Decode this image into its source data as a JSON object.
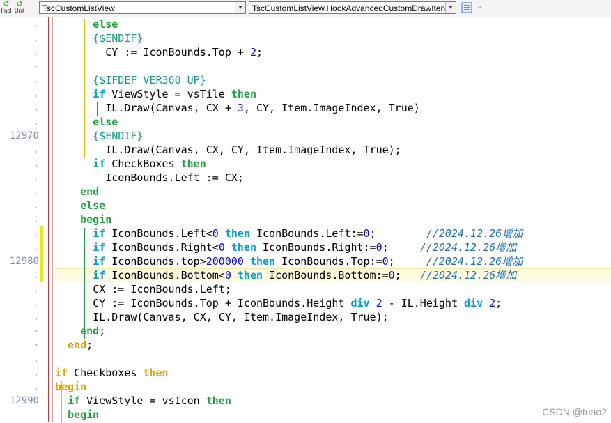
{
  "toolbar": {
    "impl_label": "Impl",
    "unit_label": "Unit",
    "class_combo": "TscCustomListView",
    "method_combo": "TscCustomListView.HookAdvancedCustomDrawIten"
  },
  "gutter": {
    "markers": [
      ".",
      ".",
      ".",
      " -",
      ".",
      ".",
      ".",
      ".",
      "12970",
      ".",
      ".",
      ".",
      ".",
      ".",
      ".",
      ".",
      ".",
      "12980",
      ".",
      ".",
      ".",
      ".",
      "-",
      "-",
      ".",
      ".",
      ".",
      "12990"
    ]
  },
  "code": [
    {
      "indent": "      ",
      "tokens": [
        {
          "t": "else",
          "c": "kwb"
        }
      ]
    },
    {
      "indent": "      ",
      "tokens": [
        {
          "t": "{$ENDIF}",
          "c": "dir"
        }
      ]
    },
    {
      "indent": "        ",
      "tokens": [
        {
          "t": "CY := IconBounds.Top + ",
          "c": "plain"
        },
        {
          "t": "2",
          "c": "num"
        },
        {
          "t": ";",
          "c": "plain"
        }
      ]
    },
    {
      "indent": "",
      "tokens": []
    },
    {
      "indent": "      ",
      "tokens": [
        {
          "t": "{$IFDEF VER360_UP}",
          "c": "dir"
        }
      ]
    },
    {
      "indent": "      ",
      "tokens": [
        {
          "t": "if",
          "c": "kw"
        },
        {
          "t": " ViewStyle = vsTile ",
          "c": "plain"
        },
        {
          "t": "then",
          "c": "kwb"
        }
      ]
    },
    {
      "indent": "        ",
      "tokens": [
        {
          "t": "IL.Draw(Canvas, CX + ",
          "c": "plain"
        },
        {
          "t": "3",
          "c": "num"
        },
        {
          "t": ", CY, Item.ImageIndex, True)",
          "c": "plain"
        }
      ]
    },
    {
      "indent": "      ",
      "tokens": [
        {
          "t": "else",
          "c": "kwb"
        }
      ]
    },
    {
      "indent": "      ",
      "tokens": [
        {
          "t": "{$ENDIF}",
          "c": "dir"
        }
      ]
    },
    {
      "indent": "        ",
      "tokens": [
        {
          "t": "IL.Draw(Canvas, CX, CY, Item.ImageIndex, True);",
          "c": "plain"
        }
      ]
    },
    {
      "indent": "      ",
      "tokens": [
        {
          "t": "if",
          "c": "kw"
        },
        {
          "t": " CheckBoxes ",
          "c": "plain"
        },
        {
          "t": "then",
          "c": "kwb"
        }
      ]
    },
    {
      "indent": "        ",
      "tokens": [
        {
          "t": "IconBounds.Left := CX;",
          "c": "plain"
        }
      ]
    },
    {
      "indent": "    ",
      "tokens": [
        {
          "t": "end",
          "c": "kwb"
        }
      ]
    },
    {
      "indent": "    ",
      "tokens": [
        {
          "t": "else",
          "c": "kwb"
        }
      ]
    },
    {
      "indent": "    ",
      "tokens": [
        {
          "t": "begin",
          "c": "kwb"
        }
      ]
    },
    {
      "indent": "      ",
      "tokens": [
        {
          "t": "if",
          "c": "kw"
        },
        {
          "t": " IconBounds.Left<",
          "c": "plain"
        },
        {
          "t": "0",
          "c": "num"
        },
        {
          "t": " ",
          "c": "plain"
        },
        {
          "t": "then",
          "c": "kw"
        },
        {
          "t": " IconBounds.Left:=",
          "c": "plain"
        },
        {
          "t": "0",
          "c": "num"
        },
        {
          "t": ";        ",
          "c": "plain"
        },
        {
          "t": "//2024.12.26增加",
          "c": "cmt"
        }
      ]
    },
    {
      "indent": "      ",
      "tokens": [
        {
          "t": "if",
          "c": "kw"
        },
        {
          "t": " IconBounds.Right<",
          "c": "plain"
        },
        {
          "t": "0",
          "c": "num"
        },
        {
          "t": " ",
          "c": "plain"
        },
        {
          "t": "then",
          "c": "kw"
        },
        {
          "t": " IconBounds.Right:=",
          "c": "plain"
        },
        {
          "t": "0",
          "c": "num"
        },
        {
          "t": ";     ",
          "c": "plain"
        },
        {
          "t": "//2024.12.26增加",
          "c": "cmt"
        }
      ]
    },
    {
      "indent": "      ",
      "tokens": [
        {
          "t": "if",
          "c": "kw"
        },
        {
          "t": " IconBounds.top>",
          "c": "plain"
        },
        {
          "t": "200000",
          "c": "num"
        },
        {
          "t": " ",
          "c": "plain"
        },
        {
          "t": "then",
          "c": "kw"
        },
        {
          "t": " IconBounds.Top:=",
          "c": "plain"
        },
        {
          "t": "0",
          "c": "num"
        },
        {
          "t": ";     ",
          "c": "plain"
        },
        {
          "t": "//2024.12.26增加",
          "c": "cmt"
        }
      ]
    },
    {
      "indent": "      ",
      "tokens": [
        {
          "t": "if",
          "c": "kw"
        },
        {
          "t": " IconBounds.Bottom<",
          "c": "plain"
        },
        {
          "t": "0",
          "c": "num"
        },
        {
          "t": " ",
          "c": "plain"
        },
        {
          "t": "then",
          "c": "kw"
        },
        {
          "t": " IconBounds.Bottom:=",
          "c": "plain"
        },
        {
          "t": "0",
          "c": "num"
        },
        {
          "t": ";   ",
          "c": "plain"
        },
        {
          "t": "//2024.12.26增加",
          "c": "cmt"
        }
      ]
    },
    {
      "indent": "      ",
      "tokens": [
        {
          "t": "CX := IconBounds.Left;",
          "c": "plain"
        }
      ]
    },
    {
      "indent": "      ",
      "tokens": [
        {
          "t": "CY := IconBounds.Top + IconBounds.Height ",
          "c": "plain"
        },
        {
          "t": "div",
          "c": "kw"
        },
        {
          "t": " ",
          "c": "plain"
        },
        {
          "t": "2",
          "c": "num"
        },
        {
          "t": " - IL.Height ",
          "c": "plain"
        },
        {
          "t": "div",
          "c": "kw"
        },
        {
          "t": " ",
          "c": "plain"
        },
        {
          "t": "2",
          "c": "num"
        },
        {
          "t": ";",
          "c": "plain"
        }
      ]
    },
    {
      "indent": "      ",
      "tokens": [
        {
          "t": "IL.Draw(Canvas, CX, CY, Item.ImageIndex, True);",
          "c": "plain"
        }
      ]
    },
    {
      "indent": "    ",
      "tokens": [
        {
          "t": "end",
          "c": "kwb"
        },
        {
          "t": ";",
          "c": "plain"
        }
      ]
    },
    {
      "indent": "  ",
      "tokens": [
        {
          "t": "end",
          "c": "kwo"
        },
        {
          "t": ";",
          "c": "plain"
        }
      ]
    },
    {
      "indent": "",
      "tokens": []
    },
    {
      "indent": "",
      "tokens": [
        {
          "t": "if",
          "c": "kwo"
        },
        {
          "t": " Checkboxes ",
          "c": "plain"
        },
        {
          "t": "then",
          "c": "kwo"
        }
      ]
    },
    {
      "indent": "",
      "tokens": [
        {
          "t": "begin",
          "c": "kwo"
        }
      ]
    },
    {
      "indent": "  ",
      "tokens": [
        {
          "t": "if",
          "c": "kwb"
        },
        {
          "t": " ViewStyle = vsIcon ",
          "c": "plain"
        },
        {
          "t": "then",
          "c": "kwb"
        }
      ]
    },
    {
      "indent": "  ",
      "tokens": [
        {
          "t": "begin",
          "c": "kwb"
        }
      ]
    }
  ],
  "current_line_index": 18,
  "watermark": "CSDN @tuao2"
}
